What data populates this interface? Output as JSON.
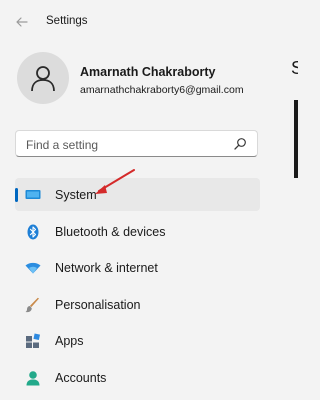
{
  "window": {
    "title": "Settings"
  },
  "user": {
    "name": "Amarnath Chakraborty",
    "email": "amarnathchakraborty6@gmail.com"
  },
  "search": {
    "placeholder": "Find a setting",
    "icon": "search-icon"
  },
  "nav": {
    "items": [
      {
        "label": "System",
        "icon": "system-icon",
        "selected": true
      },
      {
        "label": "Bluetooth & devices",
        "icon": "bluetooth-icon",
        "selected": false
      },
      {
        "label": "Network & internet",
        "icon": "wifi-icon",
        "selected": false
      },
      {
        "label": "Personalisation",
        "icon": "brush-icon",
        "selected": false
      },
      {
        "label": "Apps",
        "icon": "apps-icon",
        "selected": false
      },
      {
        "label": "Accounts",
        "icon": "accounts-icon",
        "selected": false
      }
    ]
  },
  "colors": {
    "accent": "#0067c0",
    "annotation_arrow": "#d42a2a",
    "background": "#f3f3f3",
    "selected_bg": "#e8e8e8"
  }
}
